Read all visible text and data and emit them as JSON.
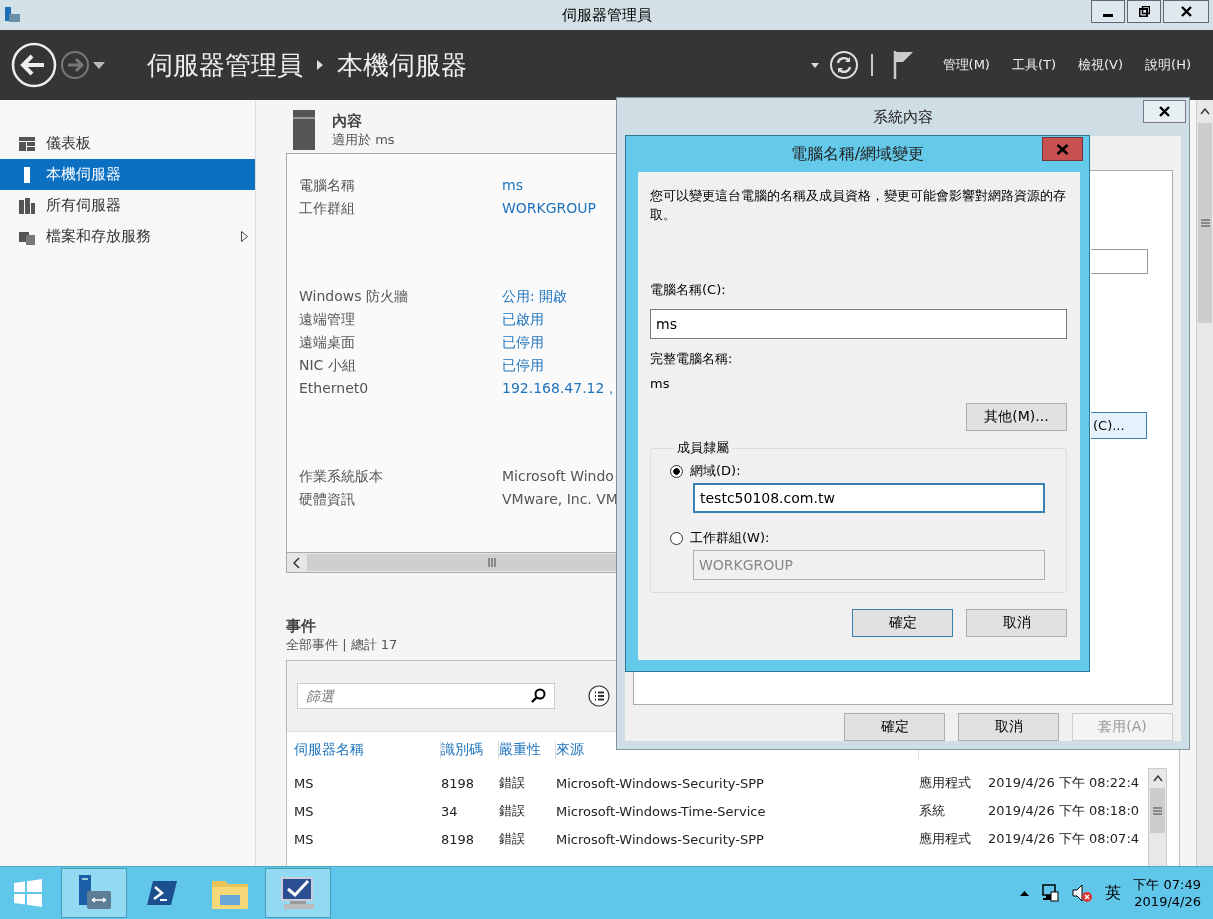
{
  "window": {
    "title": "伺服器管理員"
  },
  "header": {
    "breadcrumb": [
      "伺服器管理員",
      "本機伺服器"
    ],
    "menus": [
      "管理(M)",
      "工具(T)",
      "檢視(V)",
      "說明(H)"
    ]
  },
  "sidebar": {
    "items": [
      {
        "label": "儀表板",
        "selected": false,
        "has_submenu": false
      },
      {
        "label": "本機伺服器",
        "selected": true,
        "has_submenu": false
      },
      {
        "label": "所有伺服器",
        "selected": false,
        "has_submenu": false
      },
      {
        "label": "檔案和存放服務",
        "selected": false,
        "has_submenu": true
      }
    ]
  },
  "properties": {
    "title": "內容",
    "subtitle": "適用於 ms",
    "groups": [
      [
        {
          "label": "電腦名稱",
          "value": "ms",
          "link": true
        },
        {
          "label": "工作群組",
          "value": "WORKGROUP",
          "link": true
        }
      ],
      [
        {
          "label": "Windows 防火牆",
          "value": "公用: 開啟",
          "link": true
        },
        {
          "label": "遠端管理",
          "value": "已啟用",
          "link": true
        },
        {
          "label": "遠端桌面",
          "value": "已停用",
          "link": true
        },
        {
          "label": "NIC 小組",
          "value": "已停用",
          "link": true
        },
        {
          "label": "Ethernet0",
          "value": "192.168.47.12，",
          "link": true
        }
      ],
      [
        {
          "label": "作業系統版本",
          "value": "Microsoft Windo",
          "link": false
        },
        {
          "label": "硬體資訊",
          "value": "VMware, Inc. VM",
          "link": false
        }
      ]
    ]
  },
  "events": {
    "title": "事件",
    "subtitle": "全部事件 | 總計 17",
    "filter": {
      "placeholder": "篩選"
    },
    "columns": [
      "伺服器名稱",
      "識別碼",
      "嚴重性",
      "來源"
    ],
    "rows": [
      {
        "server": "MS",
        "id": "8198",
        "severity": "錯誤",
        "source": "Microsoft-Windows-Security-SPP",
        "column_5": "應用程式",
        "column_6": "2019/4/26 下午 08:22:4"
      },
      {
        "server": "MS",
        "id": "34",
        "severity": "錯誤",
        "source": "Microsoft-Windows-Time-Service",
        "column_5": "系統",
        "column_6": "2019/4/26 下午 08:18:0"
      },
      {
        "server": "MS",
        "id": "8198",
        "severity": "錯誤",
        "source": "Microsoft-Windows-Security-SPP",
        "column_5": "應用程式",
        "column_6": "2019/4/26 下午 08:07:4"
      }
    ]
  },
  "system_properties": {
    "title": "系統內容",
    "partial_button": "(C)...",
    "buttons": [
      {
        "label": "確定",
        "disabled": false
      },
      {
        "label": "取消",
        "disabled": false
      },
      {
        "label": "套用(A)",
        "disabled": true
      }
    ]
  },
  "name_dialog": {
    "title": "電腦名稱/網域變更",
    "description": "您可以變更這台電腦的名稱及成員資格，變更可能會影響對網路資源的存取。",
    "computer_name_label": "電腦名稱(C):",
    "computer_name": "ms",
    "full_name_label": "完整電腦名稱:",
    "full_name": "ms",
    "more_button": "其他(M)...",
    "membership": {
      "title": "成員隸屬",
      "options": [
        {
          "label": "網域(D):",
          "selected": true,
          "value": "testc50108.com.tw"
        },
        {
          "label": "工作群組(W):",
          "selected": false,
          "value": "WORKGROUP"
        }
      ]
    },
    "buttons": [
      {
        "label": "確定",
        "default": true
      },
      {
        "label": "取消",
        "default": false
      }
    ]
  },
  "taskbar": {
    "apps": [
      {
        "active": true
      },
      {
        "active": false
      },
      {
        "active": false
      },
      {
        "active": true
      }
    ]
  },
  "tray": {
    "language": "英",
    "time": "下午 07:49",
    "date": "2019/4/26"
  }
}
